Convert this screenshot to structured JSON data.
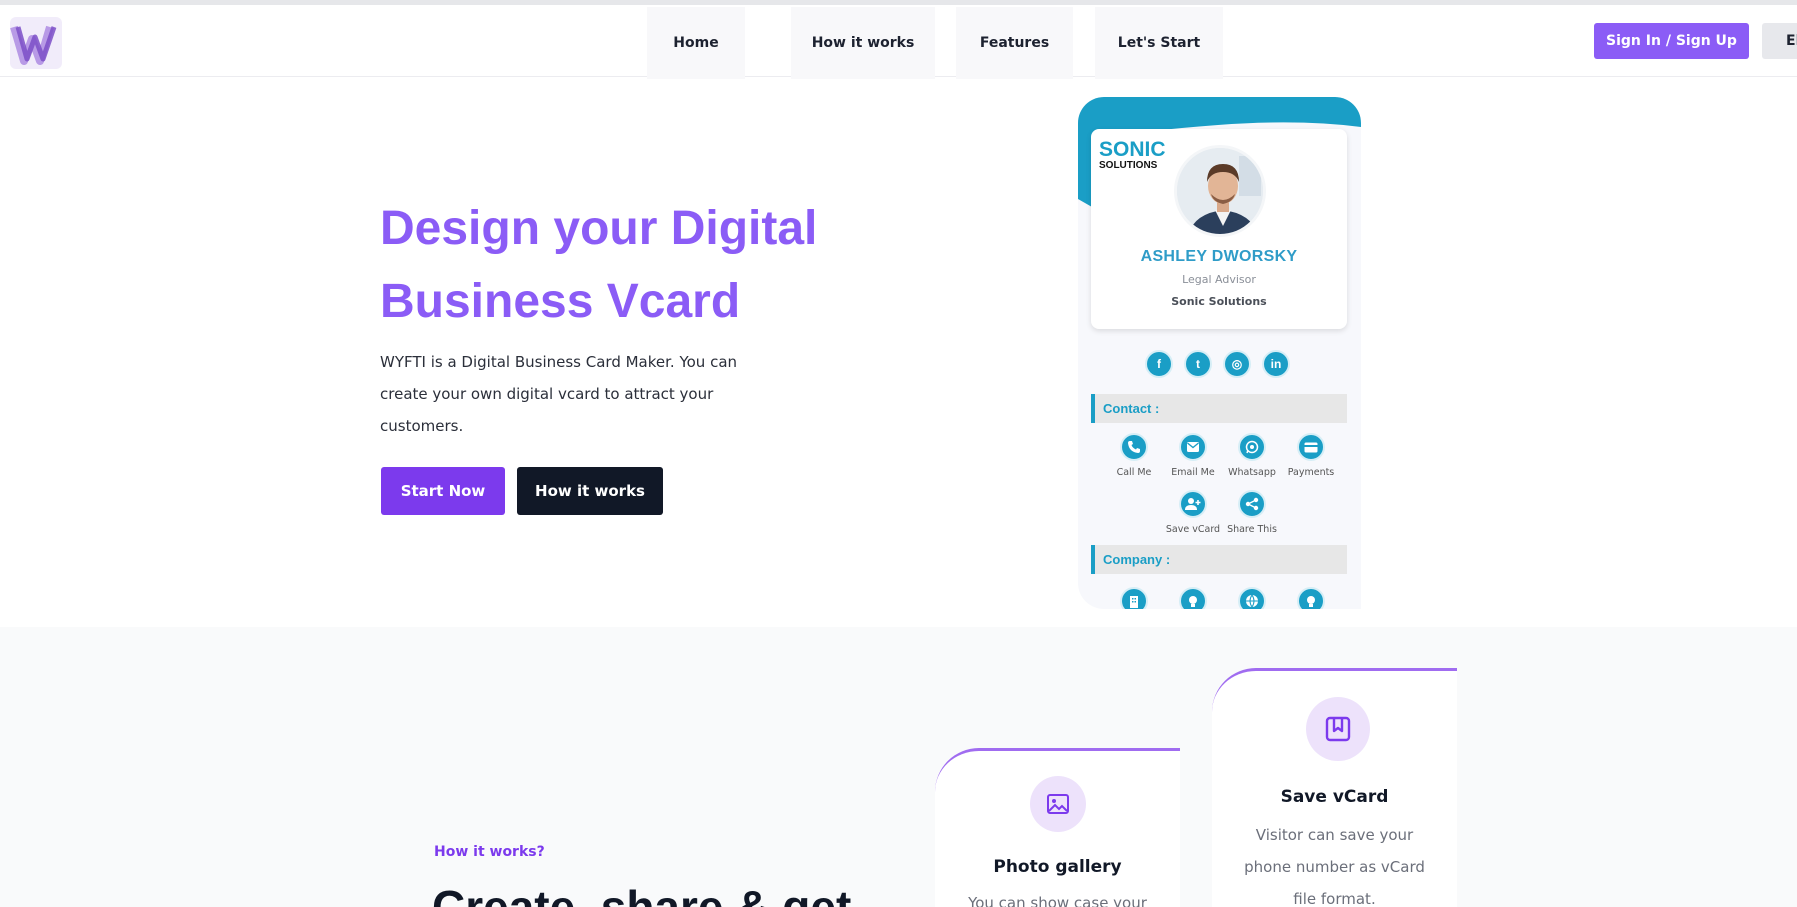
{
  "nav": {
    "logo_letter": "W",
    "items": [
      {
        "label": "Home"
      },
      {
        "label": "How it works"
      },
      {
        "label": "Features"
      },
      {
        "label": "Let's Start"
      }
    ],
    "signin_label": "Sign In / Sign Up",
    "extra_label": "El"
  },
  "hero": {
    "title": "Design your Digital Business Vcard",
    "description": "WYFTI is a Digital Business Card Maker. You can create your own digital vcard to attract your customers.",
    "start_label": "Start Now",
    "how_label": "How it works"
  },
  "vcard": {
    "brand_top": "SONIC",
    "brand_sub": "SOLUTIONS",
    "name": "ASHLEY DWORSKY",
    "role": "Legal Advisor",
    "company": "Sonic Solutions",
    "socials": [
      {
        "icon": "facebook-icon",
        "glyph": "f"
      },
      {
        "icon": "twitter-icon",
        "glyph": "t"
      },
      {
        "icon": "instagram-icon",
        "glyph": "◎"
      },
      {
        "icon": "linkedin-icon",
        "glyph": "in"
      }
    ],
    "contact_heading": "Contact :",
    "actions": [
      {
        "label": "Call Me",
        "icon": "phone-icon"
      },
      {
        "label": "Email Me",
        "icon": "email-icon"
      },
      {
        "label": "Whatsapp",
        "icon": "whatsapp-icon"
      },
      {
        "label": "Payments",
        "icon": "card-icon"
      },
      {
        "label": "Save vCard",
        "icon": "add-user-icon"
      },
      {
        "label": "Share This",
        "icon": "share-icon"
      }
    ],
    "company_heading": "Company :",
    "company_icons": [
      "building-icon",
      "bulb-icon",
      "globe-icon",
      "bulb-icon"
    ],
    "accent_color": "#1a9ec6"
  },
  "how": {
    "kicker": "How it works?",
    "title": "Create, share & get"
  },
  "features": [
    {
      "title": "Photo gallery",
      "desc": "You can show case your",
      "icon": "image-icon"
    },
    {
      "title": "Save vCard",
      "desc": "Visitor can save your phone number as vCard file format.",
      "icon": "bookmark-icon"
    }
  ],
  "colors": {
    "brand_purple": "#8b5cf6",
    "button_purple": "#7c3aed",
    "dark": "#111827"
  }
}
